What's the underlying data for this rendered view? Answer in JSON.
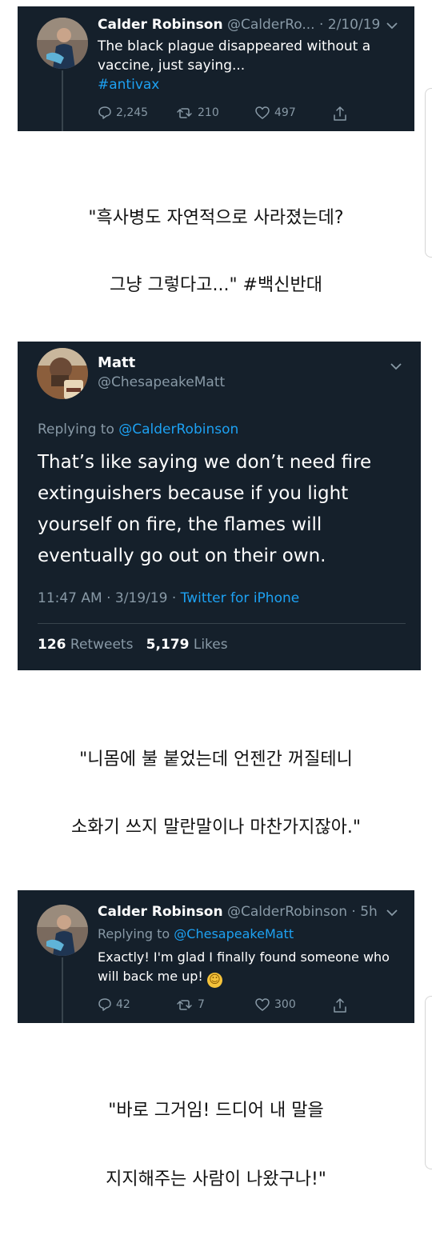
{
  "tweet1": {
    "name": "Calder Robinson",
    "handle": "@CalderRo...",
    "dot": "·",
    "time": "2/10/19",
    "text": "The black plague disappeared without a vaccine, just saying...",
    "hashtag": "#antivax",
    "replies": "2,245",
    "retweets": "210",
    "likes": "497"
  },
  "caption1": {
    "line1": "\"흑사병도 자연적으로 사라졌는데?",
    "line2": "그냥 그렇다고...\" #백신반대"
  },
  "tweet2": {
    "name": "Matt",
    "handle": "@ChesapeakeMatt",
    "replying_prefix": "Replying to",
    "replying_to": "@CalderRobinson",
    "text": "That’s like saying we don’t need fire extinguishers because if you light yourself on fire, the flames will eventually go out on their own.",
    "time": "11:47 AM · 3/19/19 ·",
    "source": "Twitter for iPhone",
    "retweets_count": "126",
    "retweets_label": "Retweets",
    "likes_count": "5,179",
    "likes_label": "Likes"
  },
  "caption2": {
    "line1": "\"니몸에 불 붙었는데 언젠간 꺼질테니",
    "line2": "소화기 쓰지 말란말이나 마찬가지잖아.\""
  },
  "tweet3": {
    "name": "Calder Robinson",
    "handle": "@CalderRobinson",
    "dot": "·",
    "time": "5h",
    "replying_prefix": "Replying to",
    "replying_to": "@ChesapeakeMatt",
    "text": "Exactly! I'm glad I finally found someone who will back me up!",
    "emoji": "☺",
    "replies": "42",
    "retweets": "7",
    "likes": "300"
  },
  "caption3": {
    "line1": "\"바로 그거임! 드디어 내 말을",
    "line2": "지지해주는 사람이 나왔구나!\""
  },
  "colors": {
    "card_bg": "#15202b",
    "accent": "#1da1f2",
    "muted": "#8899a6"
  }
}
